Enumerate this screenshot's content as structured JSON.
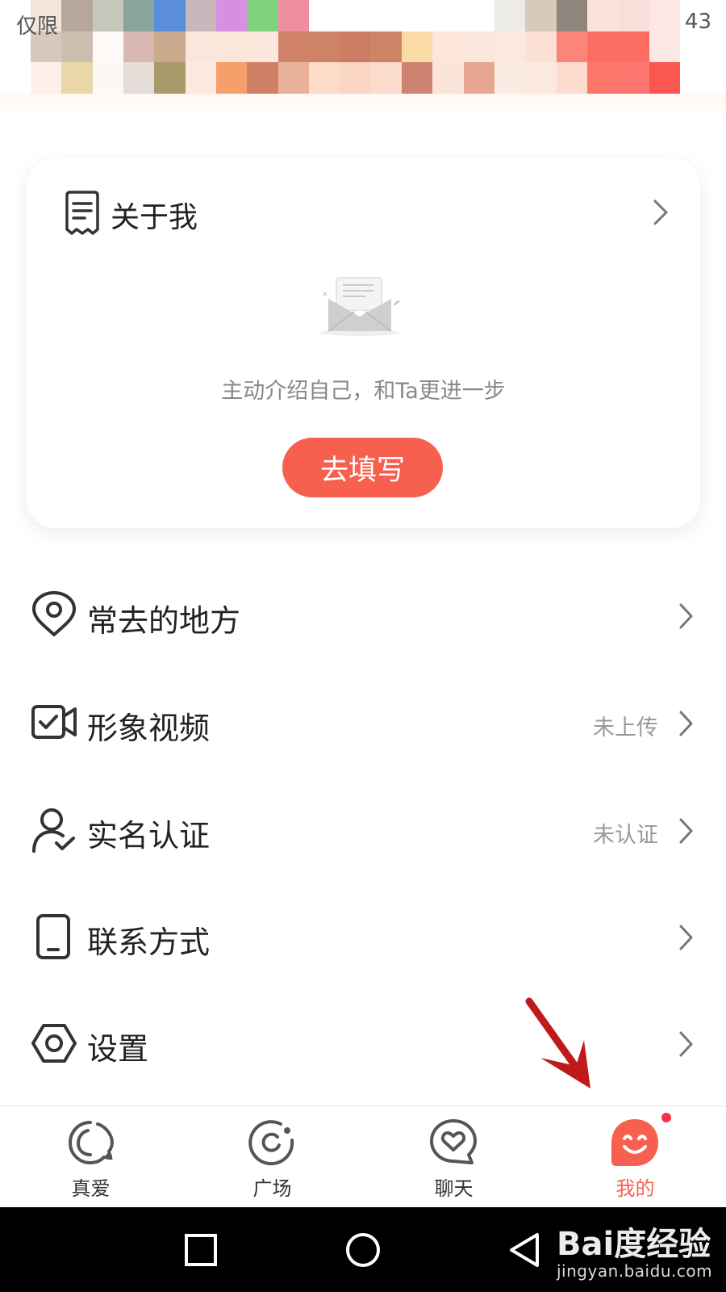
{
  "status_bar": {
    "left_text": "仅限",
    "right_text": "43"
  },
  "header": {
    "mosaic_colors": [
      "#f1e5dc",
      "#b6a89b",
      "#c6c8bb",
      "#8aa69c",
      "#5b8ed8",
      "#c7b8bb",
      "#d78fe0",
      "#7fd37d",
      "#ef8e9f",
      "#ffffff",
      "#ffffff",
      "#ffffff",
      "#ffffff",
      "#ffffff",
      "#ffffff",
      "#ecebe8",
      "#d8cabb",
      "#8f857d",
      "#fbe3da",
      "#f9dfd9",
      "#fbe8e4",
      "#d7c8bd",
      "#cdbfb0",
      "#fdf9f6",
      "#d8b8b2",
      "#cba98f",
      "#fbe6db",
      "#fbe6da",
      "#fbe7dc",
      "#cf8268",
      "#cf8366",
      "#cc7e65",
      "#cf8468",
      "#fbdba5",
      "#fbe6d9",
      "#fbe7dd",
      "#fbe8e0",
      "#fbe0d3",
      "#fc857a",
      "#fc6e62",
      "#fb6c61",
      "#fbe8e4",
      "#fff0e9",
      "#e9d7a8",
      "#fbf8f5",
      "#e6ddd8",
      "#a69b69",
      "#fbeadd",
      "#f59f6a",
      "#d08066",
      "#e9b199",
      "#fcdcc9",
      "#fbd5c4",
      "#fbdccc",
      "#ce8270",
      "#fbe5d9",
      "#e6a692",
      "#fcebe2",
      "#fbe9df",
      "#fddccf",
      "#fc7669",
      "#fc766f",
      "#f9574f"
    ]
  },
  "about_card": {
    "title": "关于我",
    "hint": "主动介绍自己，和Ta更进一步",
    "button_label": "去填写"
  },
  "menu": {
    "items": [
      {
        "label": "常去的地方",
        "status": "",
        "icon": "location-pin-icon"
      },
      {
        "label": "形象视频",
        "status": "未上传",
        "icon": "video-check-icon"
      },
      {
        "label": "实名认证",
        "status": "未认证",
        "icon": "user-verified-icon"
      },
      {
        "label": "联系方式",
        "status": "",
        "icon": "phone-icon"
      },
      {
        "label": "设置",
        "status": "",
        "icon": "settings-hexagon-icon"
      }
    ]
  },
  "tabs": [
    {
      "label": "真爱",
      "icon": "heart-bubble-icon",
      "active": false
    },
    {
      "label": "广场",
      "icon": "plaza-circle-icon",
      "active": false
    },
    {
      "label": "聊天",
      "icon": "chat-heart-icon",
      "active": false
    },
    {
      "label": "我的",
      "icon": "smiley-profile-icon",
      "active": true
    }
  ],
  "colors": {
    "accent": "#f7604f",
    "notification": "#f2354a",
    "text_secondary": "#999999"
  },
  "watermark": {
    "brand": "Bai度经验",
    "url": "jingyan.baidu.com"
  }
}
